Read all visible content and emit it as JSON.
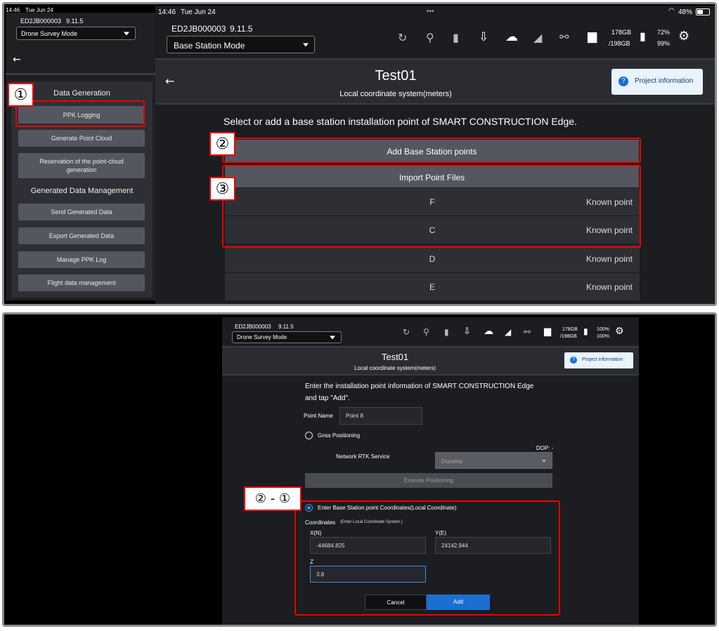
{
  "top": {
    "status_left_time": "14:46",
    "status_left_date": "Tue Jun 24",
    "status_time": "14:46",
    "status_date": "Tue Jun 24",
    "battery_pct": "48%",
    "device_id": "ED2JB000003",
    "version": "9.11.5",
    "left_mode": "Drone Survey Mode",
    "mode": "Base Station Mode",
    "storage_top": "178GB",
    "storage_bottom": "/198GB",
    "pct_top": "72%",
    "pct_bottom": "99%",
    "project_title": "Test01",
    "coord_system": "Local coordinate system(meters)",
    "project_info": "Project information",
    "sidebar": {
      "section1": "Data Generation",
      "btn_ppk": "PPK Logging",
      "btn_gen_cloud": "Generate Point Cloud",
      "btn_reservation": "Reservation of the point-cloud generation",
      "section2": "Generated Data Management",
      "btn_send": "Send Generated Data",
      "btn_export": "Export Generated Data",
      "btn_manage": "Manage PPK Log",
      "btn_flight": "Flight data management"
    },
    "instruction": "Select or add a base station installation point of SMART CONSTRUCTION Edge.",
    "add_points": "Add Base Station points",
    "import_files": "Import Point Files",
    "points": [
      {
        "name": "F",
        "type": "Known point"
      },
      {
        "name": "C",
        "type": "Known point"
      },
      {
        "name": "D",
        "type": "Known point"
      },
      {
        "name": "E",
        "type": "Known point"
      }
    ],
    "callout1": "①",
    "callout2": "②",
    "callout3": "③"
  },
  "bottom": {
    "device_id": "ED2JB000003",
    "version": "9.11.5",
    "mode": "Drone Survey Mode",
    "storage_top": "178GB",
    "storage_bottom": "/198GB",
    "pct_top": "100%",
    "pct_bottom": "100%",
    "project_title": "Test01",
    "coord_system": "Local coordinate system(meters)",
    "project_info": "Project information",
    "instruction_1": "Enter the installation point information of SMART CONSTRUCTION Edge",
    "instruction_2": "and tap \"Add\".",
    "point_name_label": "Point Name",
    "point_name_value": "Point 8",
    "gnss_label": "Gnss Positioning",
    "dop": "DOP: -",
    "rtk_label": "Network RTK Service",
    "rtk_value": "Docomo",
    "execute": "Execute Positioning",
    "enter_coords": "Enter Base Station point Coordinates(Local Coordinate)",
    "coords_label": "Coordinates",
    "coords_hint": "(Enter Local Coordinate System.)",
    "xn_label": "X(N)",
    "xn_value": "-44684.825",
    "ye_label": "Y(E)",
    "ye_value": "24142.944",
    "z_label": "Z",
    "z_value": "3.8",
    "cancel": "Cancel",
    "add": "Add",
    "callout": "② - ①"
  },
  "colors": {
    "accent": "#1a6fd0",
    "annotation": "#e00000",
    "info_bg": "#e8f3fc"
  }
}
